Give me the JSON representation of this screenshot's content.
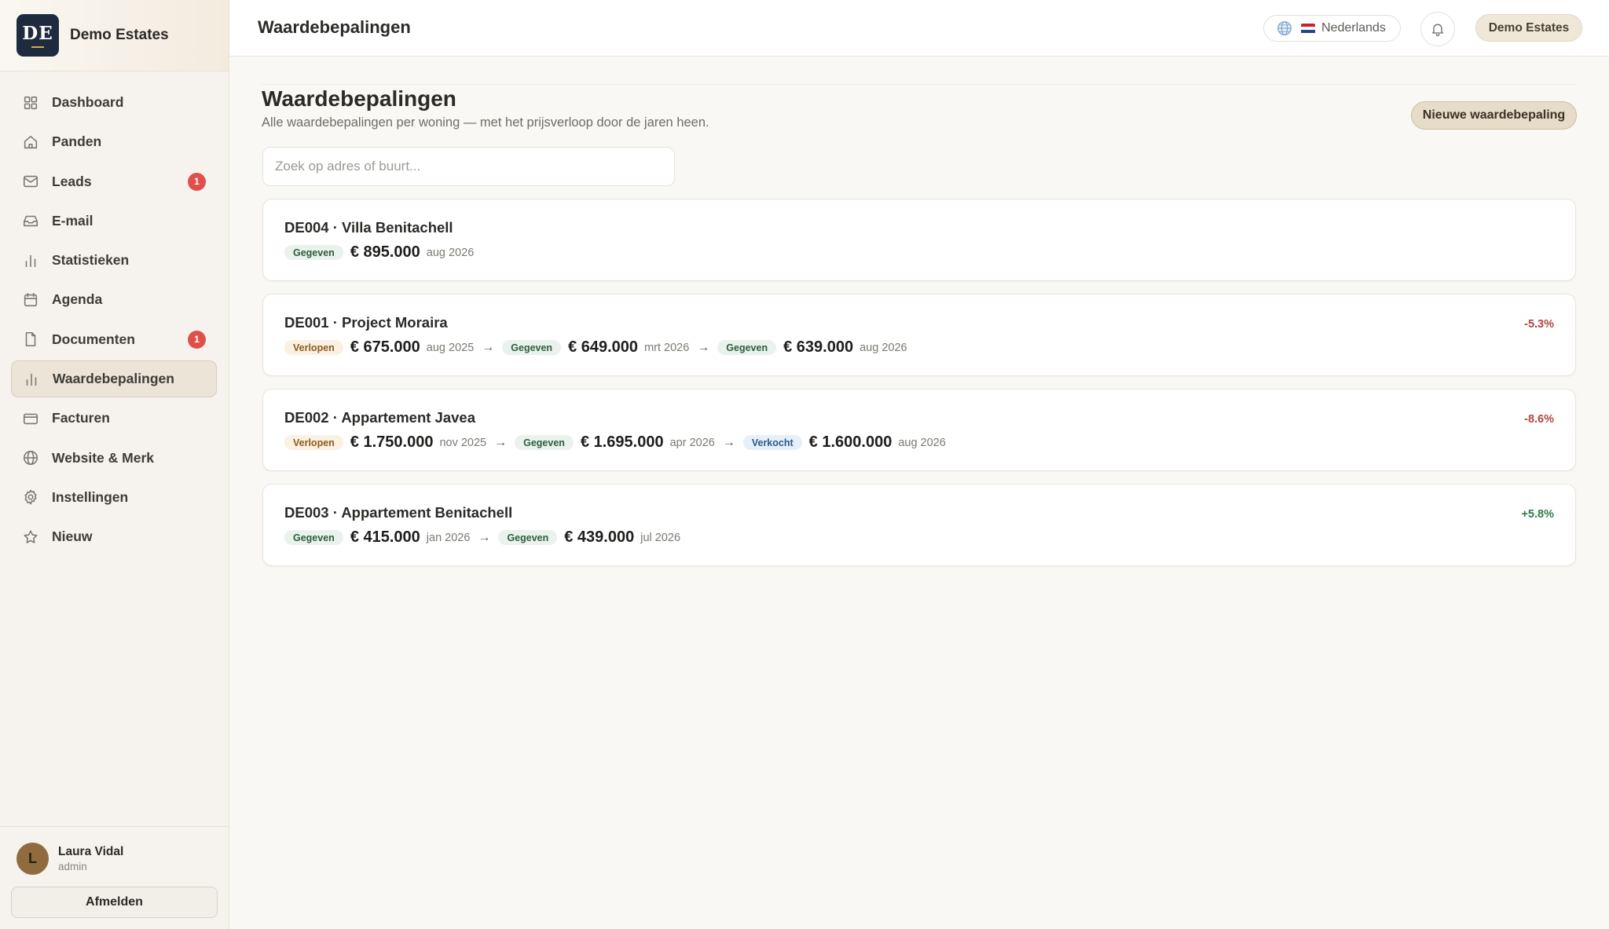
{
  "brand": {
    "logo_text": "DE",
    "name": "Demo Estates"
  },
  "nav": [
    {
      "label": "Dashboard",
      "icon": "grid-icon",
      "badge": null,
      "active": false
    },
    {
      "label": "Panden",
      "icon": "house-icon",
      "badge": null,
      "active": false
    },
    {
      "label": "Leads",
      "icon": "mail-icon",
      "badge": "1",
      "active": false
    },
    {
      "label": "E-mail",
      "icon": "inbox-icon",
      "badge": null,
      "active": false
    },
    {
      "label": "Statistieken",
      "icon": "bar-chart-icon",
      "badge": null,
      "active": false
    },
    {
      "label": "Agenda",
      "icon": "calendar-icon",
      "badge": null,
      "active": false
    },
    {
      "label": "Documenten",
      "icon": "document-icon",
      "badge": "1",
      "active": false
    },
    {
      "label": "Waardebepalingen",
      "icon": "bar-chart-icon",
      "badge": null,
      "active": true
    },
    {
      "label": "Facturen",
      "icon": "credit-card-icon",
      "badge": null,
      "active": false
    },
    {
      "label": "Website & Merk",
      "icon": "globe-icon",
      "badge": null,
      "active": false
    },
    {
      "label": "Instellingen",
      "icon": "gear-icon",
      "badge": null,
      "active": false
    },
    {
      "label": "Nieuw",
      "icon": "star-icon",
      "badge": null,
      "active": false
    }
  ],
  "user": {
    "initial": "L",
    "name": "Laura Vidal",
    "role": "admin",
    "logout_label": "Afmelden"
  },
  "topbar": {
    "title": "Waardebepalingen",
    "language": "Nederlands",
    "org": "Demo Estates"
  },
  "page": {
    "title": "Waardebepalingen",
    "subtitle": "Alle waardebepalingen per woning — met het prijsverloop door de jaren heen.",
    "new_button": "Nieuwe waardebepaling",
    "search_placeholder": "Zoek op adres of buurt..."
  },
  "properties": [
    {
      "title": "DE004 · Villa Benitachell",
      "delta": "",
      "delta_type": "",
      "valuations": [
        {
          "status": "Gegeven",
          "status_type": "given",
          "price": "€ 895.000",
          "date": "aug 2026"
        }
      ]
    },
    {
      "title": "DE001 · Project Moraira",
      "delta": "-5.3%",
      "delta_type": "neg",
      "valuations": [
        {
          "status": "Verlopen",
          "status_type": "expired",
          "price": "€ 675.000",
          "date": "aug 2025"
        },
        {
          "status": "Gegeven",
          "status_type": "given",
          "price": "€ 649.000",
          "date": "mrt 2026"
        },
        {
          "status": "Gegeven",
          "status_type": "given",
          "price": "€ 639.000",
          "date": "aug 2026"
        }
      ]
    },
    {
      "title": "DE002 · Appartement Javea",
      "delta": "-8.6%",
      "delta_type": "neg",
      "valuations": [
        {
          "status": "Verlopen",
          "status_type": "expired",
          "price": "€ 1.750.000",
          "date": "nov 2025"
        },
        {
          "status": "Gegeven",
          "status_type": "given",
          "price": "€ 1.695.000",
          "date": "apr 2026"
        },
        {
          "status": "Verkocht",
          "status_type": "sold",
          "price": "€ 1.600.000",
          "date": "aug 2026"
        }
      ]
    },
    {
      "title": "DE003 · Appartement Benitachell",
      "delta": "+5.8%",
      "delta_type": "pos",
      "valuations": [
        {
          "status": "Gegeven",
          "status_type": "given",
          "price": "€ 415.000",
          "date": "jan 2026"
        },
        {
          "status": "Gegeven",
          "status_type": "given",
          "price": "€ 439.000",
          "date": "jul 2026"
        }
      ]
    }
  ],
  "arrow_glyph": "→",
  "colors": {
    "accent": "#ece4d6",
    "badge": "#e0504b",
    "negative": "#b0463b",
    "positive": "#2f7a4b",
    "status_given": "#e9f2ec",
    "status_expired": "#fbf1e2",
    "status_sold": "#e6f0fa"
  }
}
